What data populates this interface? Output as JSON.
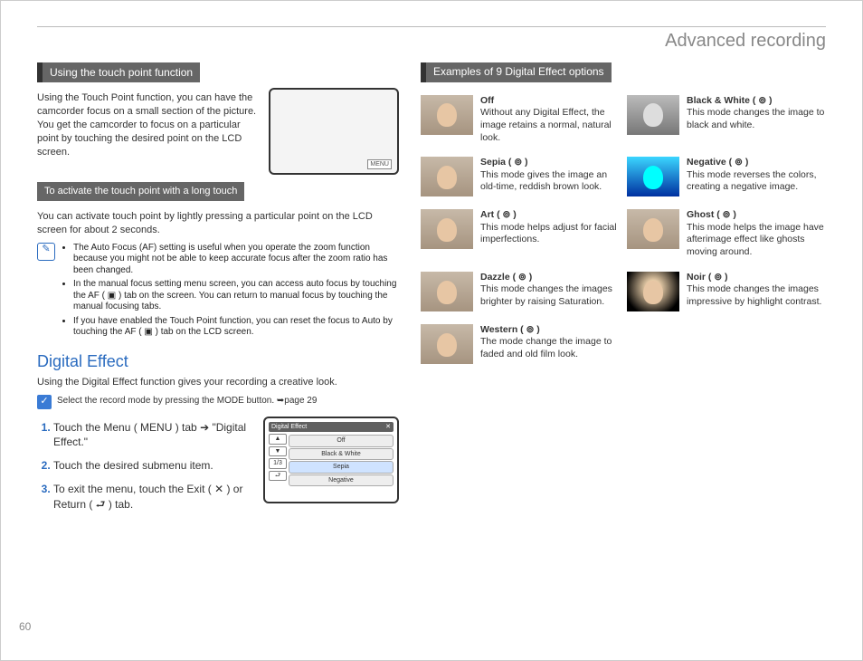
{
  "page_number": "60",
  "header": "Advanced recording",
  "left": {
    "h1": "Using the touch point function",
    "p1": "Using the Touch Point function, you can have the camcorder focus on a small section of the picture. You get the camcorder to focus on a particular point by touching the desired point on the LCD screen.",
    "shot_menu": "MENU",
    "h2": "To activate the touch point with a long touch",
    "p2": "You can activate touch point by lightly pressing a particular point on the LCD screen for about 2 seconds.",
    "notes": [
      "The Auto Focus (AF) setting is useful when you operate the zoom function because you might not be able to keep accurate focus after the zoom ratio has been changed.",
      "In the manual focus setting menu screen, you can access auto focus by touching the AF ( ▣ ) tab on the screen. You can return to manual focus by touching the manual focusing tabs.",
      "If you have enabled the Touch Point function, you can reset the focus to Auto by touching the AF ( ▣ ) tab on the LCD screen."
    ],
    "h3": "Digital Effect",
    "p3": "Using the Digital Effect function gives your recording a creative look.",
    "check": "Select the record mode by pressing the MODE button. ➥page 29",
    "steps": [
      "Touch the Menu ( MENU ) tab ➔ \"Digital Effect.\"",
      "Touch the desired submenu item.",
      "To exit the menu, touch the Exit ( ✕ ) or Return ( ⮐ ) tab."
    ],
    "menushot": {
      "title": "Digital Effect",
      "close": "✕",
      "up": "▲",
      "down": "▼",
      "page": "1/3",
      "back": "⮐",
      "items": [
        "Off",
        "Black & White",
        "Sepia",
        "Negative"
      ]
    }
  },
  "right": {
    "h1": "Examples of 9 Digital Effect options",
    "effects": [
      {
        "title": "Off",
        "variant": "",
        "desc": "Without any Digital Effect, the image retains a normal, natural look."
      },
      {
        "title": "Black & White ( ⊚ )",
        "variant": "bw",
        "desc": "This mode changes the image to black and white."
      },
      {
        "title": "Sepia ( ⊚ )",
        "variant": "",
        "desc": "This mode gives the image an old-time, reddish brown look."
      },
      {
        "title": "Negative ( ⊚ )",
        "variant": "neg",
        "desc": "This mode reverses the colors, creating a negative image."
      },
      {
        "title": "Art ( ⊚ )",
        "variant": "",
        "desc": "This mode helps adjust for facial imperfections."
      },
      {
        "title": "Ghost ( ⊚ )",
        "variant": "",
        "desc": "This mode helps the image have afterimage effect like ghosts moving around."
      },
      {
        "title": "Dazzle ( ⊚ )",
        "variant": "",
        "desc": "This mode changes the images brighter by raising Saturation."
      },
      {
        "title": "Noir ( ⊚ )",
        "variant": "noir",
        "desc": "This mode changes the images impressive by highlight contrast."
      },
      {
        "title": "Western ( ⊚ )",
        "variant": "",
        "desc": "The mode change the image to faded and old film look."
      }
    ]
  }
}
